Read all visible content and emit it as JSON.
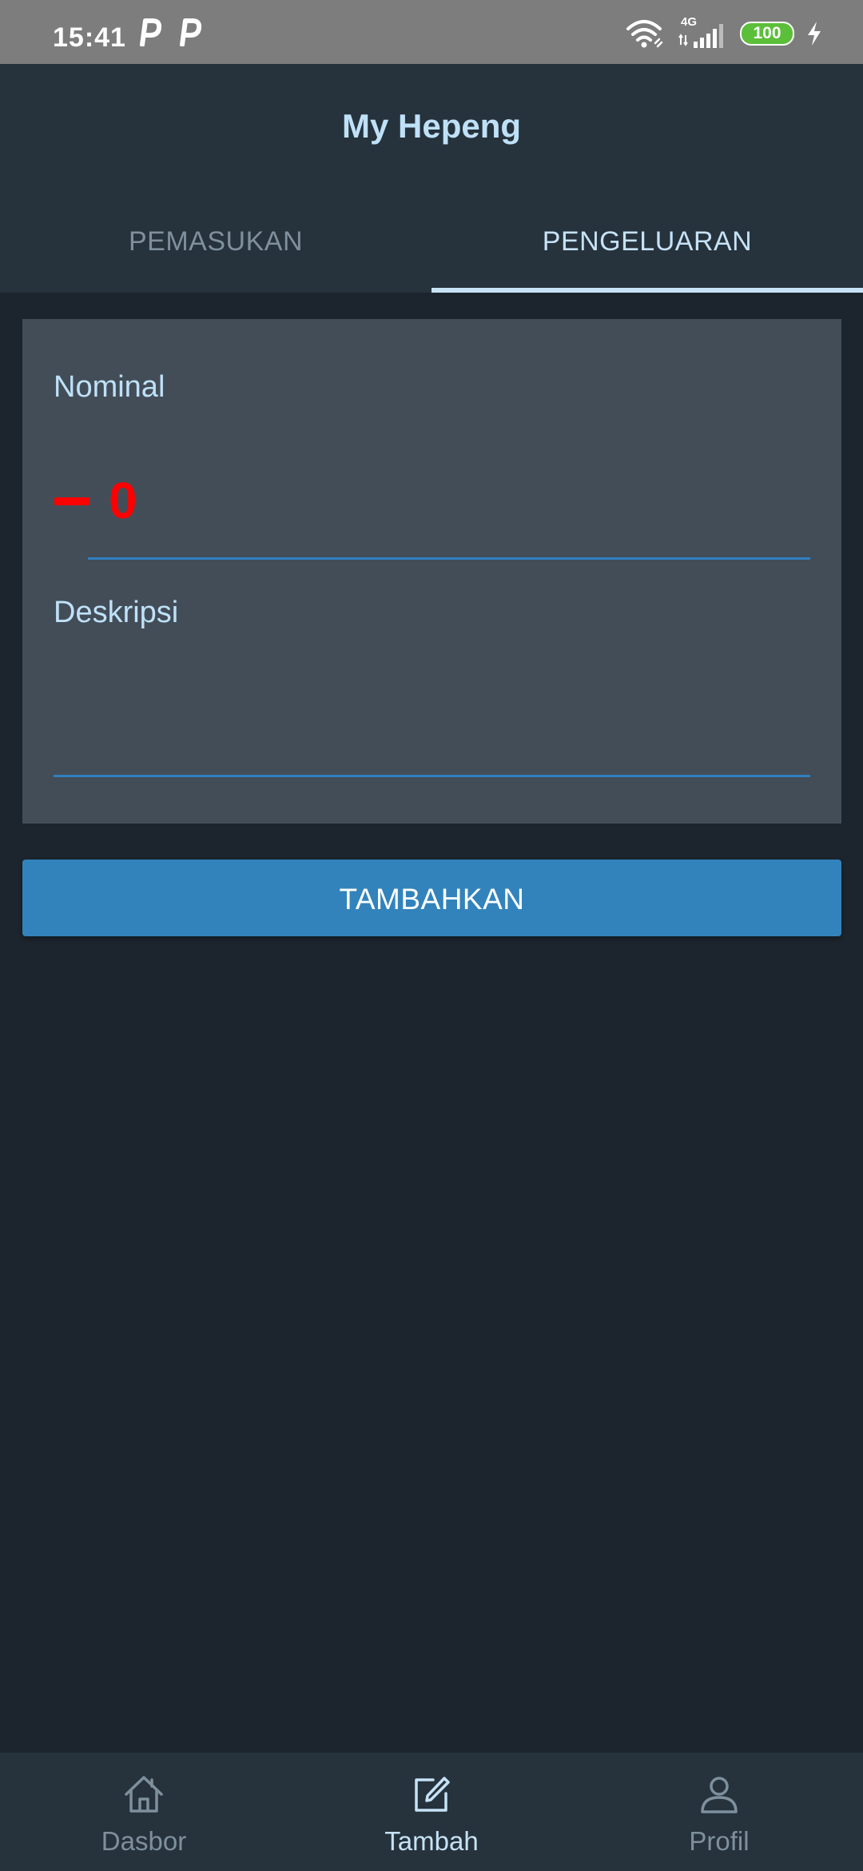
{
  "status_bar": {
    "time": "15:41",
    "notification_icons": [
      "p-app-icon",
      "p-app-icon"
    ],
    "network_label": "4G",
    "battery": "100"
  },
  "app_bar": {
    "title": "My Hepeng"
  },
  "tabs": [
    {
      "label": "PEMASUKAN",
      "selected": false
    },
    {
      "label": "PENGELUARAN",
      "selected": true
    }
  ],
  "form": {
    "nominal_label": "Nominal",
    "nominal_sign": "−",
    "nominal_value": "0",
    "description_label": "Deskripsi",
    "description_value": ""
  },
  "submit_button": {
    "label": "TAMBAHKAN"
  },
  "bottom_nav": [
    {
      "label": "Dasbor",
      "icon": "home-icon",
      "active": false
    },
    {
      "label": "Tambah",
      "icon": "edit-icon",
      "active": true
    },
    {
      "label": "Profil",
      "icon": "person-icon",
      "active": false
    }
  ],
  "colors": {
    "background": "#1c252d",
    "bar": "#26323c",
    "card": "#434d58",
    "accent": "#3283bb",
    "active_text": "#c6e2f6",
    "inactive_text": "#7f909d",
    "expense_red": "#ff0000"
  }
}
